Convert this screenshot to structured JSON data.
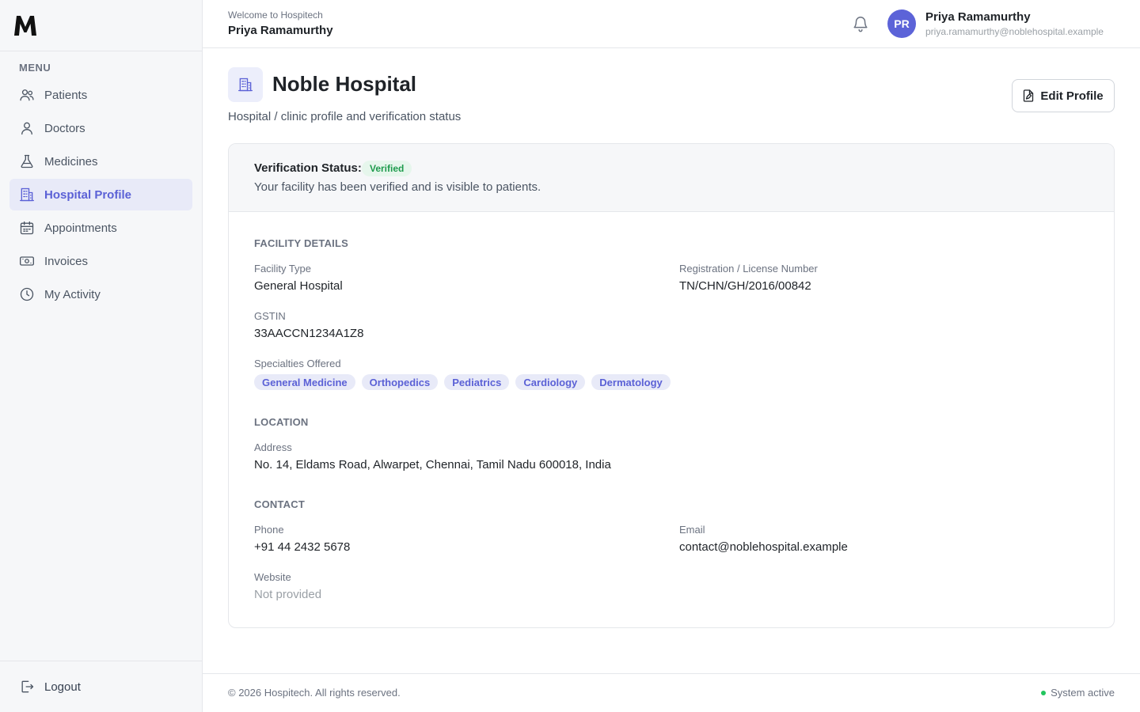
{
  "brand": {
    "logo_text": "M"
  },
  "sidebar": {
    "menu_label": "MENU",
    "items": [
      {
        "label": "Patients",
        "icon": "users-icon"
      },
      {
        "label": "Doctors",
        "icon": "user-icon"
      },
      {
        "label": "Medicines",
        "icon": "flask-icon"
      },
      {
        "label": "Hospital Profile",
        "icon": "building-icon",
        "active": true
      },
      {
        "label": "Appointments",
        "icon": "calendar-icon"
      },
      {
        "label": "Invoices",
        "icon": "banknote-icon"
      },
      {
        "label": "My Activity",
        "icon": "clock-icon"
      }
    ],
    "logout_label": "Logout"
  },
  "header": {
    "welcome": "Welcome to Hospitech",
    "user_name": "Priya Ramamurthy",
    "avatar_initials": "PR",
    "profile_name": "Priya Ramamurthy",
    "profile_email": "priya.ramamurthy@noblehospital.example"
  },
  "page": {
    "title": "Noble Hospital",
    "subtitle": "Hospital / clinic profile and verification status",
    "edit_label": "Edit Profile"
  },
  "verification": {
    "label": "Verification Status:",
    "status": "Verified",
    "message": "Your facility has been verified and is visible to patients."
  },
  "facility": {
    "section_title": "FACILITY DETAILS",
    "type_label": "Facility Type",
    "type_value": "General Hospital",
    "reg_label": "Registration / License Number",
    "reg_value": "TN/CHN/GH/2016/00842",
    "gstin_label": "GSTIN",
    "gstin_value": "33AACCN1234A1Z8",
    "specialties_label": "Specialties Offered",
    "specialties": [
      "General Medicine",
      "Orthopedics",
      "Pediatrics",
      "Cardiology",
      "Dermatology"
    ]
  },
  "location": {
    "section_title": "LOCATION",
    "address_label": "Address",
    "address_value": "No. 14, Eldams Road, Alwarpet, Chennai, Tamil Nadu 600018, India"
  },
  "contact": {
    "section_title": "CONTACT",
    "phone_label": "Phone",
    "phone_value": "+91 44 2432 5678",
    "email_label": "Email",
    "email_value": "contact@noblehospital.example",
    "website_label": "Website",
    "website_value": "Not provided"
  },
  "footer": {
    "copyright": "© 2026 Hospitech. All rights reserved.",
    "status": "System active"
  },
  "colors": {
    "accent": "#5b61d6",
    "accent_bg": "#e8eaf8",
    "success": "#1e9b4d",
    "success_bg": "#e6f6ec"
  }
}
